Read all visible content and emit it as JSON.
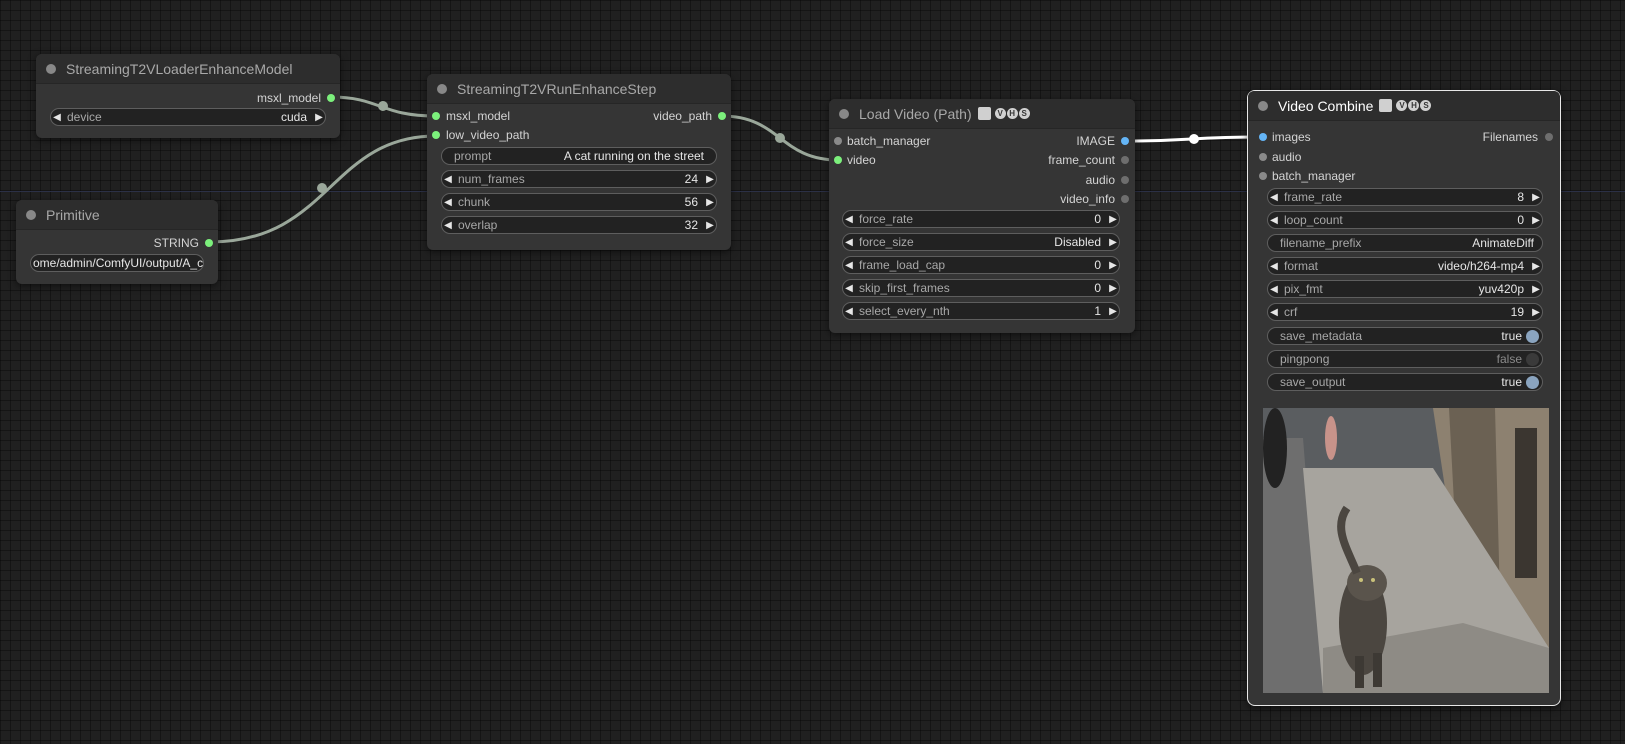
{
  "nodes": {
    "loader": {
      "title": "StreamingT2VLoaderEnhanceModel",
      "output": "msxl_model",
      "widget": {
        "label": "device",
        "value": "cuda"
      }
    },
    "primitive": {
      "title": "Primitive",
      "output": "STRING",
      "value": "ome/admin/ComfyUI/output/A_c"
    },
    "run_step": {
      "title": "StreamingT2VRunEnhanceStep",
      "inputs": [
        "msxl_model",
        "low_video_path"
      ],
      "output": "video_path",
      "prompt": {
        "label": "prompt",
        "value": "A cat running on the street"
      },
      "widgets": [
        {
          "label": "num_frames",
          "value": "24"
        },
        {
          "label": "chunk",
          "value": "56"
        },
        {
          "label": "overlap",
          "value": "32"
        }
      ]
    },
    "load_video": {
      "title": "Load Video (Path)",
      "badges": "VHS",
      "inputs": [
        "batch_manager",
        "video"
      ],
      "outputs": [
        "IMAGE",
        "frame_count",
        "audio",
        "video_info"
      ],
      "widgets": [
        {
          "label": "force_rate",
          "value": "0"
        },
        {
          "label": "force_size",
          "value": "Disabled"
        },
        {
          "label": "frame_load_cap",
          "value": "0"
        },
        {
          "label": "skip_first_frames",
          "value": "0"
        },
        {
          "label": "select_every_nth",
          "value": "1"
        }
      ]
    },
    "video_combine": {
      "title": "Video Combine",
      "badges": "VHS",
      "inputs": [
        "images",
        "audio",
        "batch_manager"
      ],
      "output": "Filenames",
      "widgets": [
        {
          "label": "frame_rate",
          "value": "8"
        },
        {
          "label": "loop_count",
          "value": "0"
        }
      ],
      "filename_prefix": {
        "label": "filename_prefix",
        "value": "AnimateDiff"
      },
      "widgets2": [
        {
          "label": "format",
          "value": "video/h264-mp4"
        },
        {
          "label": "pix_fmt",
          "value": "yuv420p"
        },
        {
          "label": "crf",
          "value": "19"
        }
      ],
      "toggles": [
        {
          "label": "save_metadata",
          "value": "true"
        },
        {
          "label": "pingpong",
          "value": "false"
        },
        {
          "label": "save_output",
          "value": "true"
        }
      ]
    }
  },
  "colors": {
    "background": "#202020",
    "node": "#353535",
    "link": "#9aa79a",
    "image_link": "#ffffff",
    "accent_green": "#7cf07c",
    "accent_blue": "#64b5f6"
  }
}
